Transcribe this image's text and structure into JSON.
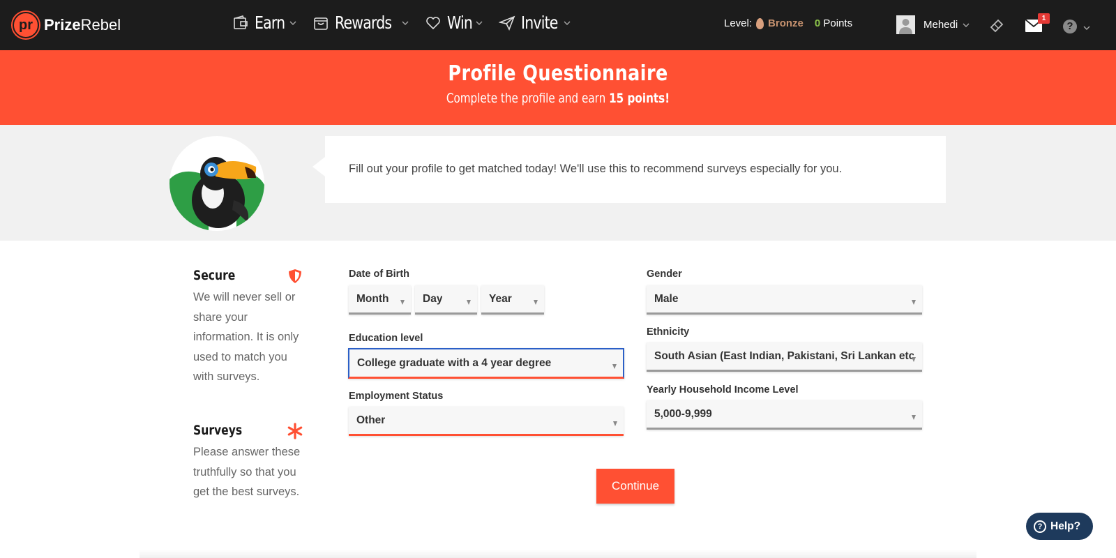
{
  "header": {
    "logo_mark": "pr",
    "logo_bold": "Prize",
    "logo_rest": "Rebel",
    "nav": [
      {
        "label": "Earn",
        "icon": "wallet-icon"
      },
      {
        "label": "Rewards",
        "icon": "gift-box-icon"
      },
      {
        "label": "Win",
        "icon": "heart-icon"
      },
      {
        "label": "Invite",
        "icon": "paper-plane-icon"
      }
    ],
    "level_label": "Level:",
    "level_value": "Bronze",
    "points_value": "0",
    "points_label": "Points",
    "username": "Mehedi",
    "mail_badge": "1",
    "help_glyph": "?"
  },
  "banner": {
    "title": "Profile Questionnaire",
    "subtitle_pre": "Complete the profile and earn",
    "subtitle_bold": "15 points!"
  },
  "intro": {
    "message": "Fill out your profile to get matched today! We'll use this to recommend surveys especially for you."
  },
  "notes": {
    "secure_title": "Secure",
    "secure_text": "We will never sell or share your information. It is only used to match you with surveys.",
    "surveys_title": "Surveys",
    "surveys_text": "Please answer these truthfully so that you get the best surveys."
  },
  "form": {
    "dob_label": "Date of Birth",
    "month": "Month",
    "day": "Day",
    "year": "Year",
    "education_label": "Education level",
    "education_value": "College graduate with a 4 year degree",
    "employment_label": "Employment Status",
    "employment_value": "Other",
    "gender_label": "Gender",
    "gender_value": "Male",
    "ethnicity_label": "Ethnicity",
    "ethnicity_value": "South Asian (East Indian, Pakistani, Sri Lankan etc",
    "income_label": "Yearly Household Income Level",
    "income_value": "5,000-9,999",
    "continue_label": "Continue"
  },
  "help_widget": {
    "label": "Help?"
  },
  "colors": {
    "brand": "#ff5033",
    "nav_bg": "#1c1c1c",
    "bronze": "#c7926f",
    "points_green": "#8bc34a",
    "focus_blue": "#2b5fc7"
  }
}
